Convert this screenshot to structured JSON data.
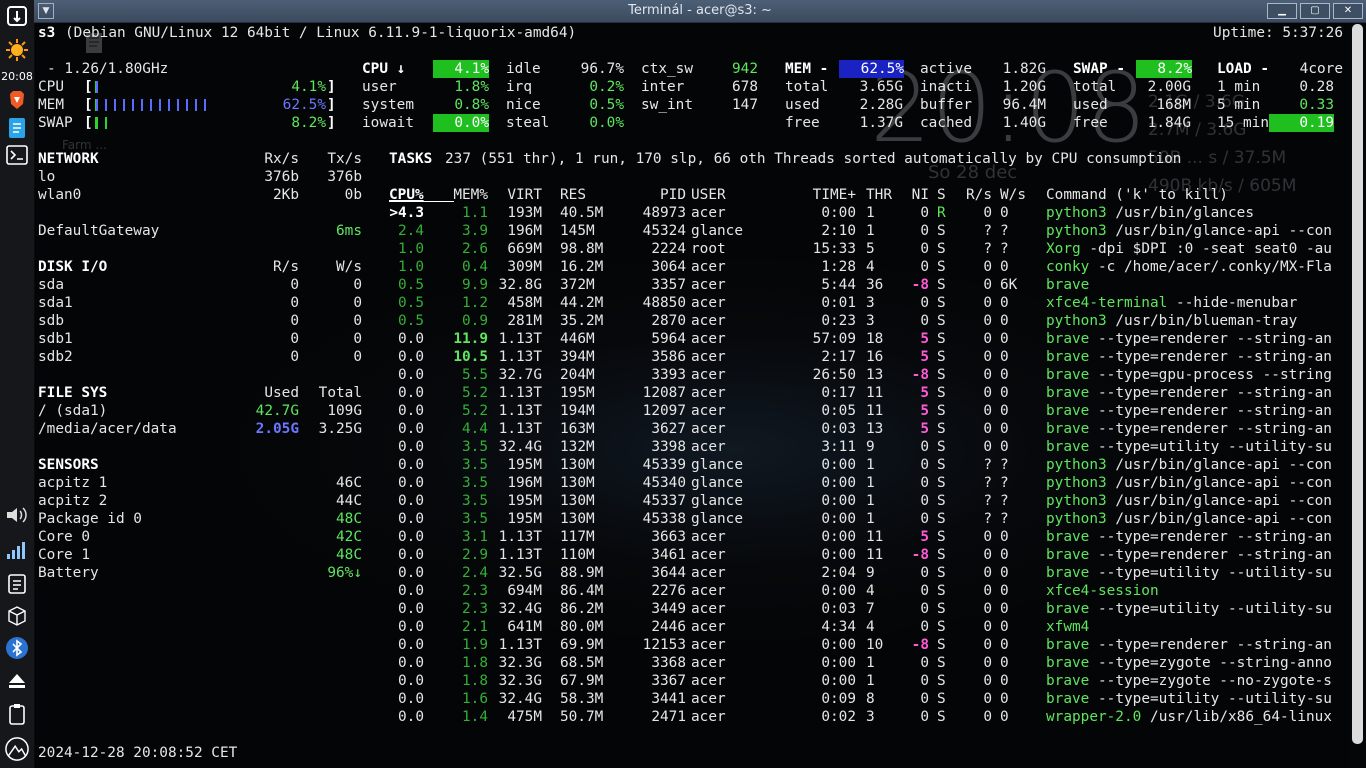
{
  "window": {
    "title": "Terminál - acer@s3: ~",
    "menu_icon": "chevron-down-icon",
    "btn_min": "minimize-icon",
    "btn_max": "maximize-icon",
    "btn_close": "close-icon"
  },
  "panel": {
    "clock": "20:08",
    "desktop_label": "Farm ..."
  },
  "conky": {
    "big_time": "20:08",
    "date": "So 28 dec",
    "l1": "2.1G / 3.6G",
    "l2": "2.7M / 3.6G",
    "l3": "50B ... s / 37.5M",
    "l4": "490B kb/s / 605M"
  },
  "header": {
    "host": "s3",
    "os": "(Debian GNU/Linux 12 64bit / Linux 6.11.9-1-liquorix-amd64)",
    "uptime": "Uptime: 5:37:26"
  },
  "quicklook": {
    "freq": "- 1.26/1.80GHz",
    "cpu_label": "CPU",
    "cpu_val": "4.1%",
    "mem_label": "MEM",
    "mem_val": "62.5%",
    "swap_label": "SWAP",
    "swap_val": "8.2%",
    "cpu_fill": 0.041,
    "mem_fill": 0.625,
    "swap_fill": 0.082
  },
  "cpu": {
    "title": "CPU ↓",
    "total": "4.1%",
    "c1": [
      {
        "k": "user",
        "v": "1.8%"
      },
      {
        "k": "system",
        "v": "0.8%"
      },
      {
        "k": "iowait",
        "v": "0.0%"
      }
    ],
    "c2": [
      {
        "k": "idle",
        "v": "96.7%"
      },
      {
        "k": "irq",
        "v": "0.2%"
      },
      {
        "k": "nice",
        "v": "0.5%"
      },
      {
        "k": "steal",
        "v": "0.0%"
      }
    ],
    "c3": [
      {
        "k": "ctx_sw",
        "v": "942"
      },
      {
        "k": "inter",
        "v": "678"
      },
      {
        "k": "sw_int",
        "v": "147"
      }
    ]
  },
  "mem": {
    "title": "MEM -",
    "total_pct": "62.5%",
    "c1": [
      {
        "k": "total",
        "v": "3.65G"
      },
      {
        "k": "used",
        "v": "2.28G"
      },
      {
        "k": "free",
        "v": "1.37G"
      }
    ],
    "c2": [
      {
        "k": "active",
        "v": "1.82G"
      },
      {
        "k": "inacti",
        "v": "1.20G"
      },
      {
        "k": "buffer",
        "v": "96.4M"
      },
      {
        "k": "cached",
        "v": "1.40G"
      }
    ]
  },
  "swap": {
    "title": "SWAP -",
    "pct": "8.2%",
    "rows": [
      {
        "k": "total",
        "v": "2.00G"
      },
      {
        "k": "used",
        "v": "168M"
      },
      {
        "k": "free",
        "v": "1.84G"
      }
    ]
  },
  "load": {
    "title": "LOAD -",
    "cores": "4core",
    "rows": [
      {
        "k": "1 min",
        "v": "0.28"
      },
      {
        "k": "5 min",
        "v": "0.33"
      },
      {
        "k": "15 min",
        "v": "0.19"
      }
    ]
  },
  "network": {
    "title": "NETWORK",
    "rx_h": "Rx/s",
    "tx_h": "Tx/s",
    "rows": [
      {
        "name": "lo",
        "rx": "376b",
        "tx": "376b"
      },
      {
        "name": "wlan0",
        "rx": "2Kb",
        "tx": "0b"
      }
    ],
    "gateway": "DefaultGateway",
    "gateway_val": "6ms"
  },
  "diskio": {
    "title": "DISK I/O",
    "r_h": "R/s",
    "w_h": "W/s",
    "rows": [
      {
        "name": "sda",
        "r": "0",
        "w": "0"
      },
      {
        "name": "sda1",
        "r": "0",
        "w": "0"
      },
      {
        "name": "sdb",
        "r": "0",
        "w": "0"
      },
      {
        "name": "sdb1",
        "r": "0",
        "w": "0"
      },
      {
        "name": "sdb2",
        "r": "0",
        "w": "0"
      }
    ]
  },
  "fs": {
    "title": "FILE SYS",
    "used_h": "Used",
    "total_h": "Total",
    "rows": [
      {
        "name": "/ (sda1)",
        "used": "42.7G",
        "total": "109G"
      },
      {
        "name": "/media/acer/data",
        "used": "2.05G",
        "total": "3.25G"
      }
    ]
  },
  "sensors": {
    "title": "SENSORS",
    "rows": [
      {
        "name": "acpitz 1",
        "v": "46C"
      },
      {
        "name": "acpitz 2",
        "v": "44C"
      },
      {
        "name": "Package id 0",
        "v": "48C"
      },
      {
        "name": "Core 0",
        "v": "42C"
      },
      {
        "name": "Core 1",
        "v": "48C"
      },
      {
        "name": "Battery",
        "v": "96%↓"
      }
    ]
  },
  "tasks": {
    "title": "TASKS",
    "summary": "237 (551 thr), 1 run, 170 slp, 66 oth Threads sorted automatically by CPU consumption"
  },
  "proc_headers": {
    "cpu": "CPU%",
    "mem": "MEM%",
    "virt": "VIRT",
    "res": "RES",
    "pid": "PID",
    "user": "USER",
    "time": "TIME+",
    "thr": "THR",
    "ni": "NI",
    "s": "S",
    "rs": "R/s",
    "ws": "W/s",
    "cmd": "Command ('k' to kill)"
  },
  "processes": [
    {
      "cpu": ">4.3",
      "mem": "1.1",
      "virt": "193M",
      "res": "40.5M",
      "pid": "48973",
      "user": "acer",
      "time": "0:00",
      "thr": "1",
      "ni": "0",
      "s": "R",
      "rs": "0",
      "ws": "0",
      "prog": "python3",
      "args": "/usr/bin/glances"
    },
    {
      "cpu": "2.4",
      "mem": "3.9",
      "virt": "196M",
      "res": "145M",
      "pid": "45324",
      "user": "glance",
      "time": "2:10",
      "thr": "1",
      "ni": "0",
      "s": "S",
      "rs": "?",
      "ws": "?",
      "prog": "python3",
      "args": "/usr/bin/glance-api --con"
    },
    {
      "cpu": "1.0",
      "mem": "2.6",
      "virt": "669M",
      "res": "98.8M",
      "pid": "2224",
      "user": "root",
      "time": "15:33",
      "thr": "5",
      "ni": "0",
      "s": "S",
      "rs": "?",
      "ws": "?",
      "prog": "Xorg",
      "args": "-dpi $DPI :0 -seat seat0 -au"
    },
    {
      "cpu": "1.0",
      "mem": "0.4",
      "virt": "309M",
      "res": "16.2M",
      "pid": "3064",
      "user": "acer",
      "time": "1:28",
      "thr": "4",
      "ni": "0",
      "s": "S",
      "rs": "0",
      "ws": "0",
      "prog": "conky",
      "args": "-c /home/acer/.conky/MX-Fla"
    },
    {
      "cpu": "0.5",
      "mem": "9.9",
      "virt": "32.8G",
      "res": "372M",
      "pid": "3357",
      "user": "acer",
      "time": "5:44",
      "thr": "36",
      "ni": "-8",
      "s": "S",
      "rs": "0",
      "ws": "6K",
      "prog": "brave",
      "args": ""
    },
    {
      "cpu": "0.5",
      "mem": "1.2",
      "virt": "458M",
      "res": "44.2M",
      "pid": "48850",
      "user": "acer",
      "time": "0:01",
      "thr": "3",
      "ni": "0",
      "s": "S",
      "rs": "0",
      "ws": "0",
      "prog": "xfce4-terminal",
      "args": "--hide-menubar"
    },
    {
      "cpu": "0.5",
      "mem": "0.9",
      "virt": "281M",
      "res": "35.2M",
      "pid": "2870",
      "user": "acer",
      "time": "0:23",
      "thr": "3",
      "ni": "0",
      "s": "S",
      "rs": "0",
      "ws": "0",
      "prog": "python3",
      "args": "/usr/bin/blueman-tray"
    },
    {
      "cpu": "0.0",
      "mem": "11.9",
      "virt": "1.13T",
      "res": "446M",
      "pid": "5964",
      "user": "acer",
      "time": "57:09",
      "thr": "18",
      "ni": "5",
      "s": "S",
      "rs": "0",
      "ws": "0",
      "prog": "brave",
      "args": "--type=renderer --string-an"
    },
    {
      "cpu": "0.0",
      "mem": "10.5",
      "virt": "1.13T",
      "res": "394M",
      "pid": "3586",
      "user": "acer",
      "time": "2:17",
      "thr": "16",
      "ni": "5",
      "s": "S",
      "rs": "0",
      "ws": "0",
      "prog": "brave",
      "args": "--type=renderer --string-an"
    },
    {
      "cpu": "0.0",
      "mem": "5.5",
      "virt": "32.7G",
      "res": "204M",
      "pid": "3393",
      "user": "acer",
      "time": "26:50",
      "thr": "13",
      "ni": "-8",
      "s": "S",
      "rs": "0",
      "ws": "0",
      "prog": "brave",
      "args": "--type=gpu-process --string"
    },
    {
      "cpu": "0.0",
      "mem": "5.2",
      "virt": "1.13T",
      "res": "195M",
      "pid": "12087",
      "user": "acer",
      "time": "0:17",
      "thr": "11",
      "ni": "5",
      "s": "S",
      "rs": "0",
      "ws": "0",
      "prog": "brave",
      "args": "--type=renderer --string-an"
    },
    {
      "cpu": "0.0",
      "mem": "5.2",
      "virt": "1.13T",
      "res": "194M",
      "pid": "12097",
      "user": "acer",
      "time": "0:05",
      "thr": "11",
      "ni": "5",
      "s": "S",
      "rs": "0",
      "ws": "0",
      "prog": "brave",
      "args": "--type=renderer --string-an"
    },
    {
      "cpu": "0.0",
      "mem": "4.4",
      "virt": "1.13T",
      "res": "163M",
      "pid": "3627",
      "user": "acer",
      "time": "0:03",
      "thr": "13",
      "ni": "5",
      "s": "S",
      "rs": "0",
      "ws": "0",
      "prog": "brave",
      "args": "--type=renderer --string-an"
    },
    {
      "cpu": "0.0",
      "mem": "3.5",
      "virt": "32.4G",
      "res": "132M",
      "pid": "3398",
      "user": "acer",
      "time": "3:11",
      "thr": "9",
      "ni": "0",
      "s": "S",
      "rs": "0",
      "ws": "0",
      "prog": "brave",
      "args": "--type=utility --utility-su"
    },
    {
      "cpu": "0.0",
      "mem": "3.5",
      "virt": "195M",
      "res": "130M",
      "pid": "45339",
      "user": "glance",
      "time": "0:00",
      "thr": "1",
      "ni": "0",
      "s": "S",
      "rs": "?",
      "ws": "?",
      "prog": "python3",
      "args": "/usr/bin/glance-api --con"
    },
    {
      "cpu": "0.0",
      "mem": "3.5",
      "virt": "196M",
      "res": "130M",
      "pid": "45340",
      "user": "glance",
      "time": "0:00",
      "thr": "1",
      "ni": "0",
      "s": "S",
      "rs": "?",
      "ws": "?",
      "prog": "python3",
      "args": "/usr/bin/glance-api --con"
    },
    {
      "cpu": "0.0",
      "mem": "3.5",
      "virt": "195M",
      "res": "130M",
      "pid": "45337",
      "user": "glance",
      "time": "0:00",
      "thr": "1",
      "ni": "0",
      "s": "S",
      "rs": "?",
      "ws": "?",
      "prog": "python3",
      "args": "/usr/bin/glance-api --con"
    },
    {
      "cpu": "0.0",
      "mem": "3.5",
      "virt": "195M",
      "res": "130M",
      "pid": "45338",
      "user": "glance",
      "time": "0:00",
      "thr": "1",
      "ni": "0",
      "s": "S",
      "rs": "?",
      "ws": "?",
      "prog": "python3",
      "args": "/usr/bin/glance-api --con"
    },
    {
      "cpu": "0.0",
      "mem": "3.1",
      "virt": "1.13T",
      "res": "117M",
      "pid": "3663",
      "user": "acer",
      "time": "0:00",
      "thr": "11",
      "ni": "5",
      "s": "S",
      "rs": "0",
      "ws": "0",
      "prog": "brave",
      "args": "--type=renderer --string-an"
    },
    {
      "cpu": "0.0",
      "mem": "2.9",
      "virt": "1.13T",
      "res": "110M",
      "pid": "3461",
      "user": "acer",
      "time": "0:00",
      "thr": "11",
      "ni": "-8",
      "s": "S",
      "rs": "0",
      "ws": "0",
      "prog": "brave",
      "args": "--type=renderer --string-an"
    },
    {
      "cpu": "0.0",
      "mem": "2.4",
      "virt": "32.5G",
      "res": "88.9M",
      "pid": "3644",
      "user": "acer",
      "time": "2:04",
      "thr": "9",
      "ni": "0",
      "s": "S",
      "rs": "0",
      "ws": "0",
      "prog": "brave",
      "args": "--type=utility --utility-su"
    },
    {
      "cpu": "0.0",
      "mem": "2.3",
      "virt": "694M",
      "res": "86.4M",
      "pid": "2276",
      "user": "acer",
      "time": "0:00",
      "thr": "4",
      "ni": "0",
      "s": "S",
      "rs": "0",
      "ws": "0",
      "prog": "xfce4-session",
      "args": ""
    },
    {
      "cpu": "0.0",
      "mem": "2.3",
      "virt": "32.4G",
      "res": "86.2M",
      "pid": "3449",
      "user": "acer",
      "time": "0:03",
      "thr": "7",
      "ni": "0",
      "s": "S",
      "rs": "0",
      "ws": "0",
      "prog": "brave",
      "args": "--type=utility --utility-su"
    },
    {
      "cpu": "0.0",
      "mem": "2.1",
      "virt": "641M",
      "res": "80.0M",
      "pid": "2446",
      "user": "acer",
      "time": "4:34",
      "thr": "4",
      "ni": "0",
      "s": "S",
      "rs": "0",
      "ws": "0",
      "prog": "xfwm4",
      "args": ""
    },
    {
      "cpu": "0.0",
      "mem": "1.9",
      "virt": "1.13T",
      "res": "69.9M",
      "pid": "12153",
      "user": "acer",
      "time": "0:00",
      "thr": "10",
      "ni": "-8",
      "s": "S",
      "rs": "0",
      "ws": "0",
      "prog": "brave",
      "args": "--type=renderer --string-an"
    },
    {
      "cpu": "0.0",
      "mem": "1.8",
      "virt": "32.3G",
      "res": "68.5M",
      "pid": "3368",
      "user": "acer",
      "time": "0:00",
      "thr": "1",
      "ni": "0",
      "s": "S",
      "rs": "0",
      "ws": "0",
      "prog": "brave",
      "args": "--type=zygote --string-anno"
    },
    {
      "cpu": "0.0",
      "mem": "1.8",
      "virt": "32.3G",
      "res": "67.9M",
      "pid": "3367",
      "user": "acer",
      "time": "0:00",
      "thr": "1",
      "ni": "0",
      "s": "S",
      "rs": "0",
      "ws": "0",
      "prog": "brave",
      "args": "--type=zygote --no-zygote-s"
    },
    {
      "cpu": "0.0",
      "mem": "1.6",
      "virt": "32.4G",
      "res": "58.3M",
      "pid": "3441",
      "user": "acer",
      "time": "0:09",
      "thr": "8",
      "ni": "0",
      "s": "S",
      "rs": "0",
      "ws": "0",
      "prog": "brave",
      "args": "--type=utility --utility-su"
    },
    {
      "cpu": "0.0",
      "mem": "1.4",
      "virt": "475M",
      "res": "50.7M",
      "pid": "2471",
      "user": "acer",
      "time": "0:02",
      "thr": "3",
      "ni": "0",
      "s": "S",
      "rs": "0",
      "ws": "0",
      "prog": "wrapper-2.0",
      "args": "/usr/lib/x86_64-linux"
    }
  ],
  "footer": {
    "datetime": "2024-12-28 20:08:52 CET"
  }
}
